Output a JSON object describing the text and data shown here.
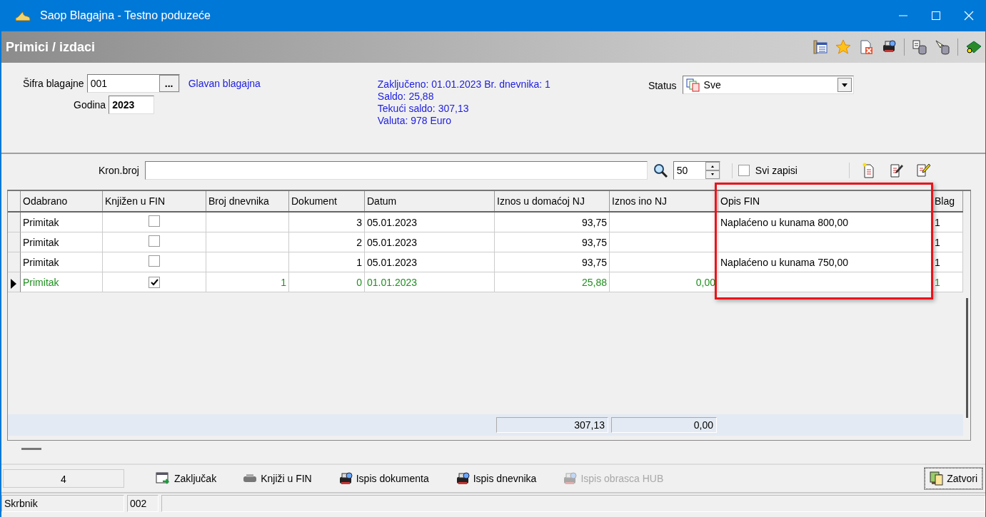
{
  "window": {
    "title": "Saop Blagajna - Testno poduzeće"
  },
  "header": {
    "title": "Primici / izdaci",
    "toolbar": [
      {
        "kind": "columns"
      },
      {
        "kind": "star"
      },
      {
        "kind": "delete-doc"
      },
      {
        "kind": "printer"
      },
      {
        "kind": "sep"
      },
      {
        "kind": "db-import"
      },
      {
        "kind": "db-export"
      },
      {
        "kind": "sep"
      },
      {
        "kind": "help-book"
      }
    ]
  },
  "form": {
    "sifra_label": "Šifra blagajne",
    "sifra_value": "001",
    "browse_button": "...",
    "blagajna_name": "Glavan blagajna",
    "godina_label": "Godina",
    "godina_value": "2023",
    "info": [
      "Zaključeno: 01.01.2023 Br. dnevnika: 1",
      "Saldo:  25,88",
      "Tekući saldo: 307,13",
      "Valuta: 978 Euro"
    ],
    "status_label": "Status",
    "status_value": "Sve"
  },
  "filter": {
    "label": "Kron.broj",
    "count": "50",
    "all_records": {
      "label": "Svi zapisi",
      "checked": false
    },
    "tools": [
      {
        "kind": "new"
      },
      {
        "kind": "edit"
      },
      {
        "kind": "edit-multi"
      }
    ]
  },
  "table": {
    "columns": [
      {
        "label": "Odabrano",
        "highlighted": false
      },
      {
        "label": "Knjižen u FIN",
        "highlighted": false
      },
      {
        "label": "Broj dnevnika",
        "highlighted": false
      },
      {
        "label": "Dokument",
        "highlighted": false
      },
      {
        "label": "Datum",
        "highlighted": false
      },
      {
        "label": "Iznos u domaćoj NJ",
        "highlighted": false
      },
      {
        "label": "Iznos ino NJ",
        "highlighted": false
      },
      {
        "label": "Opis FIN",
        "highlighted": true
      },
      {
        "label": "Blag",
        "highlighted": false
      }
    ],
    "rows": [
      {
        "current": false,
        "color": "#000000",
        "cells": [
          "Primitak",
          {
            "checked": false
          },
          "",
          "3",
          "05.01.2023",
          "93,75",
          "",
          "Naplaćeno u kunama 800,00",
          "1"
        ]
      },
      {
        "current": false,
        "color": "#000000",
        "cells": [
          "Primitak",
          {
            "checked": false
          },
          "",
          "2",
          "05.01.2023",
          "93,75",
          "",
          "",
          "1"
        ]
      },
      {
        "current": false,
        "color": "#000000",
        "cells": [
          "Primitak",
          {
            "checked": false
          },
          "",
          "1",
          "05.01.2023",
          "93,75",
          "",
          "Naplaćeno u kunama 750,00",
          "1"
        ]
      },
      {
        "current": true,
        "color": "#1f8f1f",
        "cells": [
          "Primitak",
          {
            "checked": true
          },
          "1",
          "0",
          "01.01.2023",
          "25,88",
          "0,00",
          "",
          "1"
        ]
      }
    ],
    "totals": [
      "307,13",
      "0,00"
    ]
  },
  "footer": {
    "count": "4",
    "buttons": [
      {
        "label": "Zaključak",
        "kind": "close-period",
        "disabled": false
      },
      {
        "label": "Knjiži u FIN",
        "kind": "post",
        "disabled": false
      },
      {
        "label": "Ispis dokumenta",
        "kind": "print",
        "disabled": false
      },
      {
        "label": "Ispis dnevnika",
        "kind": "print",
        "disabled": false
      },
      {
        "label": "Ispis obrasca HUB",
        "kind": "print",
        "disabled": true
      }
    ],
    "close_button": "Zatvori"
  },
  "status_bar": {
    "user": "Skrbnik",
    "code": "002"
  }
}
